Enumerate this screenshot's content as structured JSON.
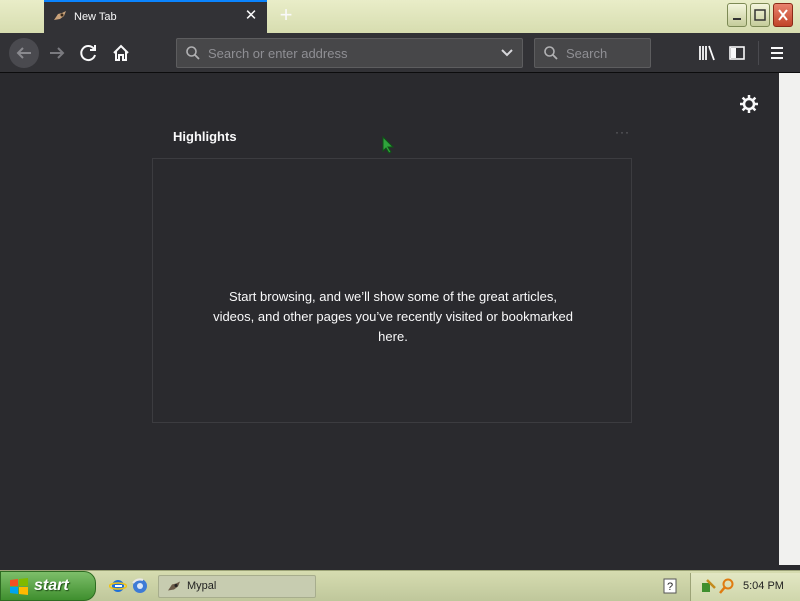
{
  "browser": {
    "tab_title": "New Tab",
    "url_placeholder": "Search or enter address",
    "search_placeholder": "Search"
  },
  "newtab": {
    "section_title": "Highlights",
    "section_menu": "···",
    "empty_message": "Start browsing, and we’ll show some of the great articles, videos, and other pages you’ve recently visited or bookmarked here."
  },
  "taskbar": {
    "start_label": "start",
    "task_label": "Mypal",
    "clock": "5:04 PM"
  },
  "colors": {
    "accent": "#0a84ff",
    "toolbar": "#323236",
    "content": "#2a2a2e"
  },
  "icons": [
    "mypal-icon",
    "close-icon",
    "plus-icon",
    "back-icon",
    "forward-icon",
    "reload-icon",
    "home-icon",
    "search-icon",
    "chevron-down-icon",
    "library-icon",
    "sidebar-icon",
    "menu-icon",
    "gear-icon",
    "windows-logo-icon",
    "ie-icon",
    "firefox-icon",
    "help-icon",
    "network-icon",
    "search-tray-icon"
  ]
}
